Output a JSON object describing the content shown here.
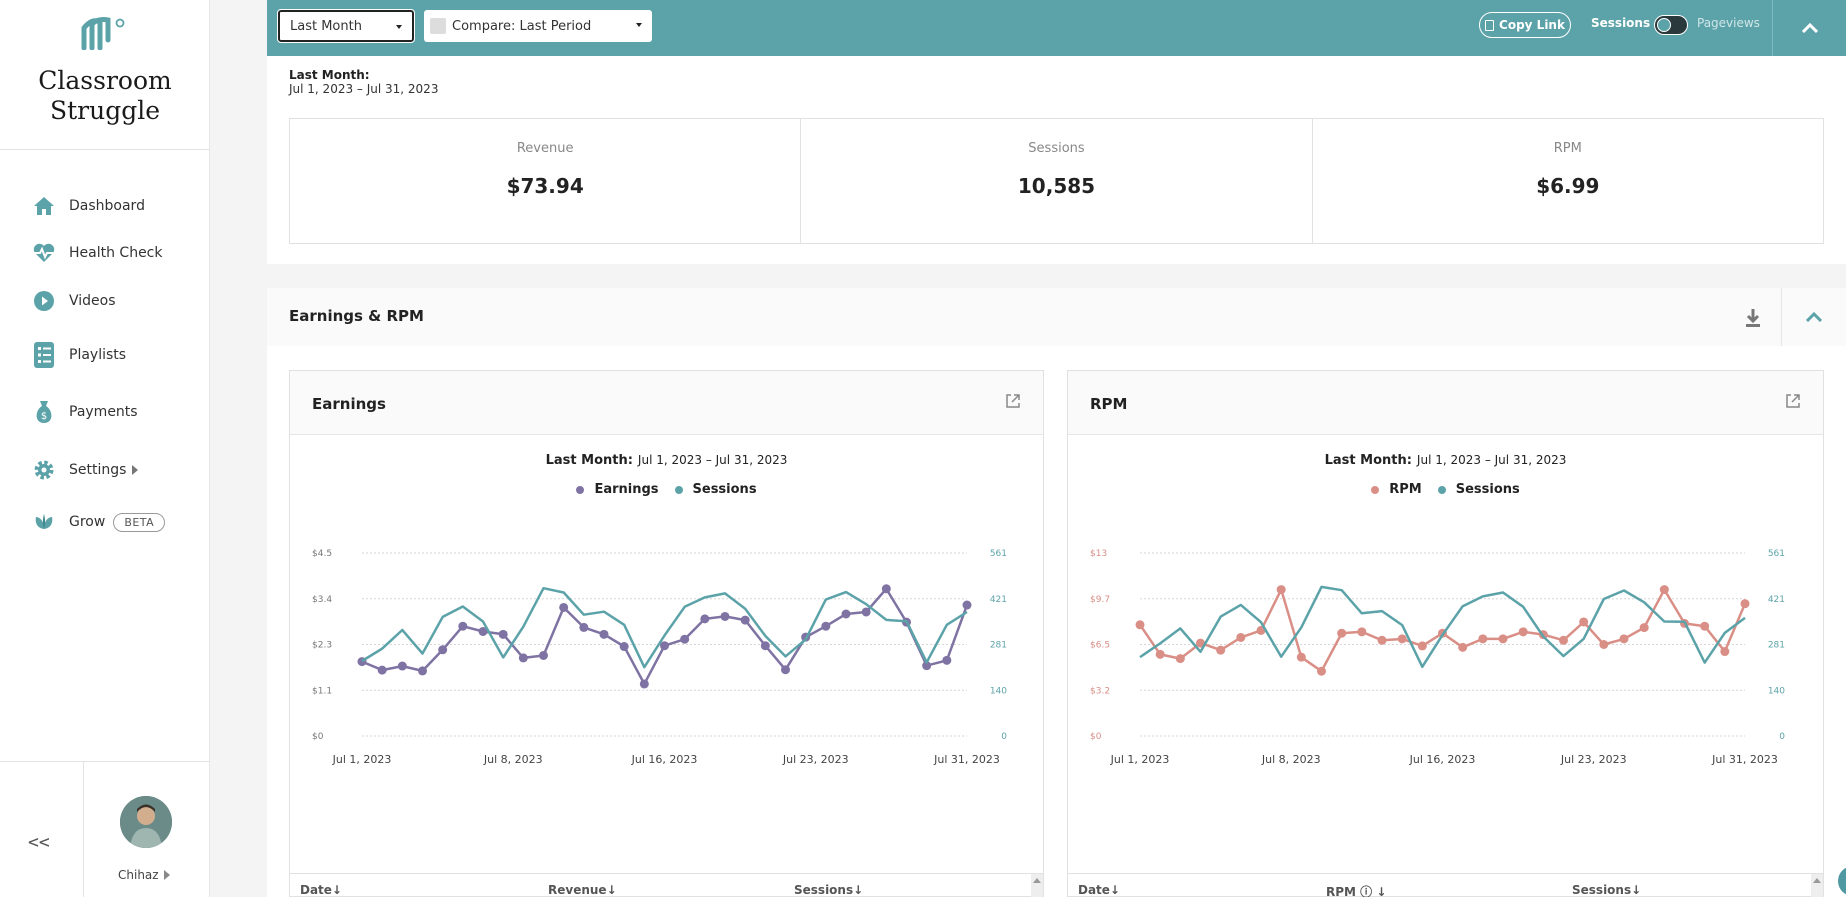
{
  "brand": {
    "line1": "Classroom",
    "line2": "Struggle"
  },
  "nav": [
    {
      "label": "Dashboard",
      "icon": "home-icon"
    },
    {
      "label": "Health Check",
      "icon": "heartbeat-icon"
    },
    {
      "label": "Videos",
      "icon": "play-icon"
    },
    {
      "label": "Playlists",
      "icon": "list-icon"
    },
    {
      "label": "Payments",
      "icon": "money-bag-icon"
    },
    {
      "label": "Settings",
      "icon": "gear-icon"
    },
    {
      "label": "Grow",
      "icon": "leaf-icon",
      "badge": "BETA"
    }
  ],
  "sidebar_bottom": {
    "collapse": "<<",
    "user": "Chihaz"
  },
  "topbar": {
    "range_select": "Last Month",
    "compare_select": "Compare: Last Period",
    "copy_link": "Copy Link",
    "toggle_left": "Sessions",
    "toggle_right": "Pageviews"
  },
  "summary": {
    "range_label": "Last Month:",
    "range_value": "Jul 1, 2023 – Jul 31, 2023",
    "cards": [
      {
        "title": "Revenue",
        "value": "$73.94"
      },
      {
        "title": "Sessions",
        "value": "10,585"
      },
      {
        "title": "RPM",
        "value": "$6.99"
      }
    ]
  },
  "section": {
    "title": "Earnings & RPM"
  },
  "colors": {
    "teal": "#5ca3a9",
    "purple": "#7f73a3",
    "salmon": "#d98e86"
  },
  "earnings_panel": {
    "title": "Earnings",
    "sub_label": "Last Month:",
    "sub_value": "Jul 1, 2023 – Jul 31, 2023",
    "table_headers": [
      "Date↓",
      "Revenue↓",
      "Sessions↓"
    ]
  },
  "rpm_panel": {
    "title": "RPM",
    "sub_label": "Last Month:",
    "sub_value": "Jul 1, 2023 – Jul 31, 2023",
    "table_headers": [
      "Date↓",
      "RPM ⓘ ↓",
      "Sessions↓"
    ]
  },
  "chart_data": [
    {
      "type": "line",
      "title": "Earnings",
      "x_labels": [
        "Jul 1, 2023",
        "Jul 8, 2023",
        "Jul 16, 2023",
        "Jul 23, 2023",
        "Jul 31, 2023"
      ],
      "y_left_ticks": [
        "$0",
        "$1.1",
        "$2.3",
        "$3.4",
        "$4.5"
      ],
      "y_right_ticks": [
        "0",
        "140",
        "281",
        "421",
        "561"
      ],
      "ylim_left": [
        0,
        4.5
      ],
      "ylim_right": [
        0,
        561
      ],
      "series": [
        {
          "name": "Earnings",
          "axis": "left",
          "color": "#7f73a3",
          "markers": true,
          "values": [
            1.83,
            1.62,
            1.72,
            1.6,
            2.12,
            2.7,
            2.57,
            2.5,
            1.92,
            1.98,
            3.16,
            2.67,
            2.5,
            2.2,
            1.28,
            2.22,
            2.38,
            2.88,
            2.94,
            2.85,
            2.22,
            1.63,
            2.43,
            2.7,
            3.0,
            3.05,
            3.62,
            2.8,
            1.73,
            1.86,
            3.22
          ]
        },
        {
          "name": "Sessions",
          "axis": "right",
          "color": "#5ca3a9",
          "markers": false,
          "values": [
            230,
            268,
            325,
            253,
            365,
            397,
            351,
            241,
            335,
            453,
            440,
            372,
            381,
            341,
            211,
            308,
            396,
            425,
            437,
            390,
            307,
            244,
            296,
            418,
            441,
            404,
            356,
            352,
            226,
            341,
            380
          ]
        }
      ]
    },
    {
      "type": "line",
      "title": "RPM",
      "x_labels": [
        "Jul 1, 2023",
        "Jul 8, 2023",
        "Jul 16, 2023",
        "Jul 23, 2023",
        "Jul 31, 2023"
      ],
      "y_left_ticks": [
        "$0",
        "$3.2",
        "$6.5",
        "$9.7",
        "$13"
      ],
      "y_right_ticks": [
        "0",
        "140",
        "281",
        "421",
        "561"
      ],
      "ylim_left": [
        0,
        13
      ],
      "ylim_right": [
        0,
        561
      ],
      "series": [
        {
          "name": "RPM",
          "axis": "left",
          "color": "#d98e86",
          "markers": true,
          "values": [
            7.9,
            5.8,
            5.5,
            6.6,
            6.1,
            7.0,
            7.5,
            10.4,
            5.6,
            4.6,
            7.3,
            7.4,
            6.8,
            6.9,
            6.4,
            7.3,
            6.3,
            6.9,
            6.9,
            7.4,
            7.2,
            6.8,
            8.1,
            6.5,
            6.9,
            7.7,
            10.4,
            8.0,
            7.8,
            6.0,
            9.4
          ]
        },
        {
          "name": "Sessions",
          "axis": "right",
          "color": "#5ca3a9",
          "markers": false,
          "values": [
            242,
            284,
            330,
            258,
            366,
            402,
            349,
            243,
            333,
            457,
            447,
            376,
            383,
            340,
            212,
            310,
            398,
            428,
            440,
            396,
            305,
            245,
            298,
            420,
            446,
            410,
            351,
            350,
            225,
            316,
            362
          ]
        }
      ]
    }
  ]
}
